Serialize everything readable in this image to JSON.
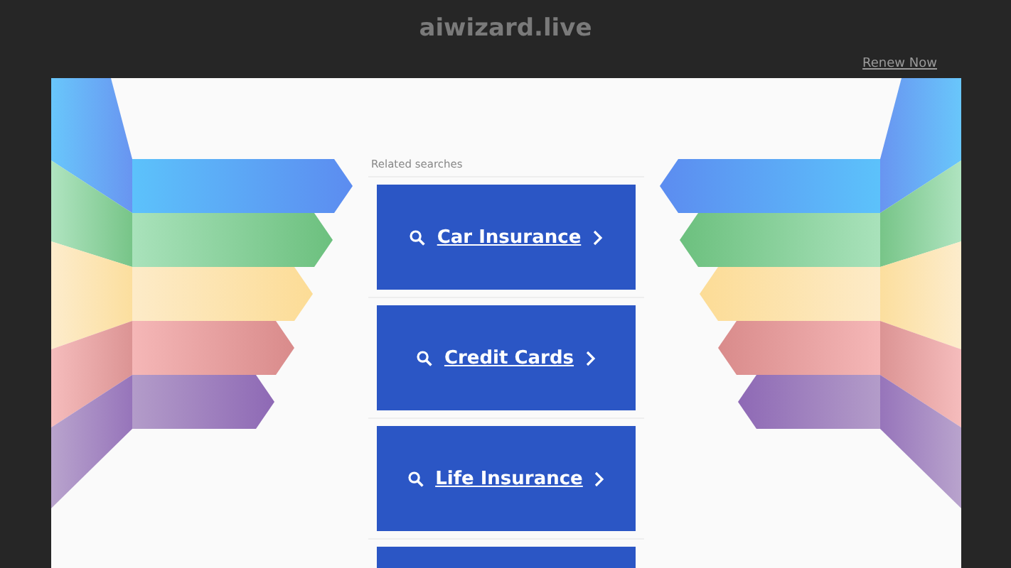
{
  "header": {
    "domain": "aiwizard.live",
    "renew_link": "Renew Now"
  },
  "related": {
    "heading": "Related searches",
    "links": [
      {
        "kind": "link",
        "label": "Car Insurance"
      },
      {
        "kind": "link",
        "label": "Credit Cards"
      },
      {
        "kind": "link",
        "label": "Life Insurance"
      },
      {
        "kind": "cut"
      }
    ]
  }
}
